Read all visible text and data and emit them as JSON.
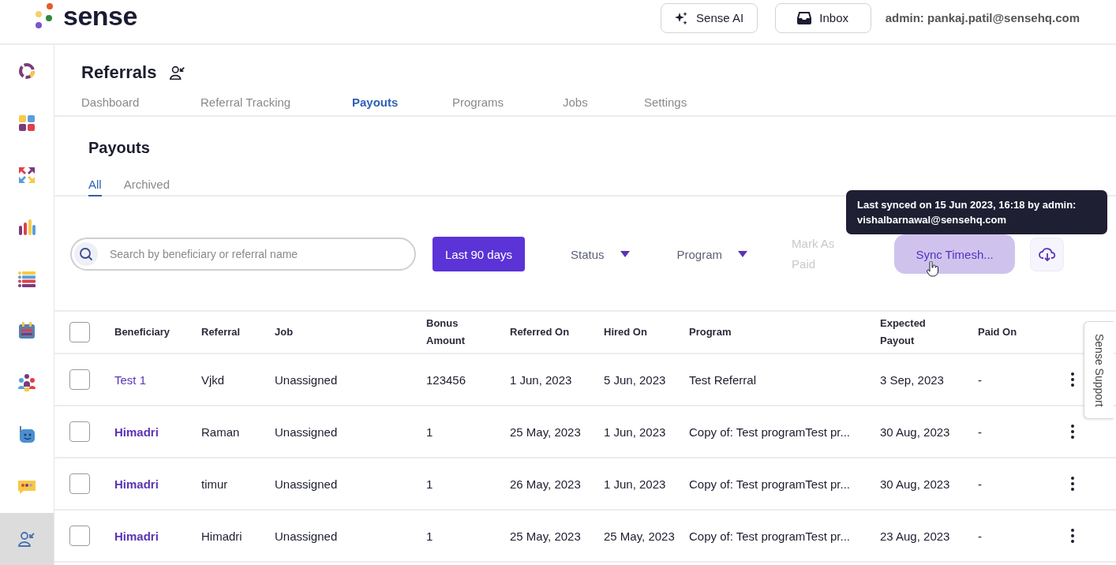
{
  "header": {
    "logo": "sense",
    "buttons": [
      {
        "kind": "ai",
        "label": "Sense AI"
      },
      {
        "kind": "inbox",
        "label": "Inbox"
      }
    ],
    "user": "admin: pankaj.patil@sensehq.com"
  },
  "sidebar": {
    "items": [
      {
        "kind": "ring",
        "selected": false
      },
      {
        "kind": "grid",
        "selected": false
      },
      {
        "kind": "arrows",
        "selected": false
      },
      {
        "kind": "bars",
        "selected": false
      },
      {
        "kind": "list",
        "selected": false
      },
      {
        "kind": "calendar",
        "selected": false
      },
      {
        "kind": "people",
        "selected": false
      },
      {
        "kind": "robot",
        "selected": false
      },
      {
        "kind": "chat",
        "selected": false
      },
      {
        "kind": "referral",
        "selected": true
      }
    ]
  },
  "page": {
    "title": "Referrals",
    "tabs": [
      {
        "label": "Dashboard",
        "selected": false
      },
      {
        "label": "Referral Tracking",
        "selected": false
      },
      {
        "label": "Payouts",
        "selected": true
      },
      {
        "label": "Programs",
        "selected": false
      },
      {
        "label": "Jobs",
        "selected": false
      },
      {
        "label": "Settings",
        "selected": false
      }
    ]
  },
  "section": {
    "title": "Payouts",
    "tabs": [
      {
        "label": "All",
        "selected": true
      },
      {
        "label": "Archived",
        "selected": false
      }
    ]
  },
  "toolbar": {
    "search": {
      "placeholder": "Search by beneficiary or referral name"
    },
    "date_button": "Last 90 days",
    "filters": [
      "Status",
      "Program"
    ],
    "mark_paid": {
      "label": "Mark As Paid",
      "disabled": true
    },
    "sync_button": "Sync Timesh...",
    "tooltip": "Last synced on 15 Jun 2023, 16:18 by admin: vishalbarnawal@sensehq.com"
  },
  "table": {
    "select_all": {
      "checked": false
    },
    "columns": [
      "Beneficiary",
      "Referral",
      "Job",
      "Bonus Amount",
      "Referred On",
      "Hired On",
      "Program",
      "Expected Payout",
      "Paid On"
    ],
    "rows": [
      {
        "checked": false,
        "cells": [
          "Test 1",
          "Vjkd",
          "Unassigned",
          "123456",
          "1 Jun, 2023",
          "5 Jun, 2023",
          "Test Referral",
          "3 Sep, 2023",
          "-"
        ]
      },
      {
        "checked": false,
        "cells": [
          "Himadri",
          "Raman",
          "Unassigned",
          "1",
          "25 May, 2023",
          "1 Jun, 2023",
          "Copy of: Test programTest pr...",
          "30 Aug, 2023",
          "-"
        ]
      },
      {
        "checked": false,
        "cells": [
          "Himadri",
          "timur",
          "Unassigned",
          "1",
          "26 May, 2023",
          "1 Jun, 2023",
          "Copy of: Test programTest pr...",
          "30 Aug, 2023",
          "-"
        ]
      },
      {
        "checked": false,
        "cells": [
          "Himadri",
          "Himadri",
          "Unassigned",
          "1",
          "25 May, 2023",
          "25 May, 2023",
          "Copy of: Test programTest pr...",
          "23 Aug, 2023",
          "-"
        ]
      }
    ]
  },
  "support_tab": "Sense Support"
}
